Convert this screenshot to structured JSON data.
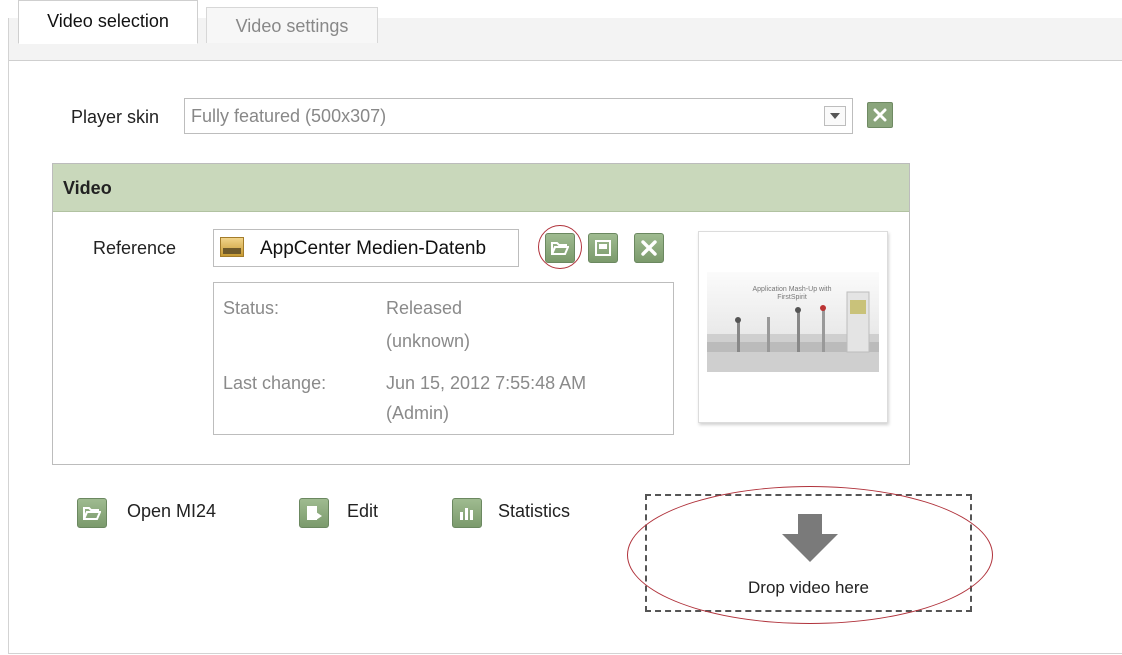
{
  "tabs": [
    {
      "label": "Video selection",
      "active": true
    },
    {
      "label": "Video settings",
      "active": false
    }
  ],
  "player_skin": {
    "label": "Player skin",
    "value": "Fully featured (500x307)"
  },
  "video_section": {
    "title": "Video",
    "reference_label": "Reference",
    "reference_value": "AppCenter Medien-Datenb",
    "status_label": "Status:",
    "status_value_1": "Released",
    "status_value_2": "(unknown)",
    "last_change_label": "Last change:",
    "last_change_value_1": "Jun 15, 2012 7:55:48 AM",
    "last_change_value_2": "(Admin)",
    "thumbnail_caption": "Application Mash-Up with FirstSpirit"
  },
  "actions": {
    "open": "Open MI24",
    "edit": "Edit",
    "statistics": "Statistics"
  },
  "drop_zone": {
    "label": "Drop video here"
  },
  "colors": {
    "accent_green": "#8aa57c",
    "header_green": "#c9d8bb",
    "highlight_red": "#b0323b"
  },
  "icons": [
    "chevron-down-icon",
    "close-icon",
    "image-icon",
    "folder-open-icon",
    "preview-icon",
    "edit-icon",
    "statistics-icon",
    "down-arrow-icon"
  ]
}
